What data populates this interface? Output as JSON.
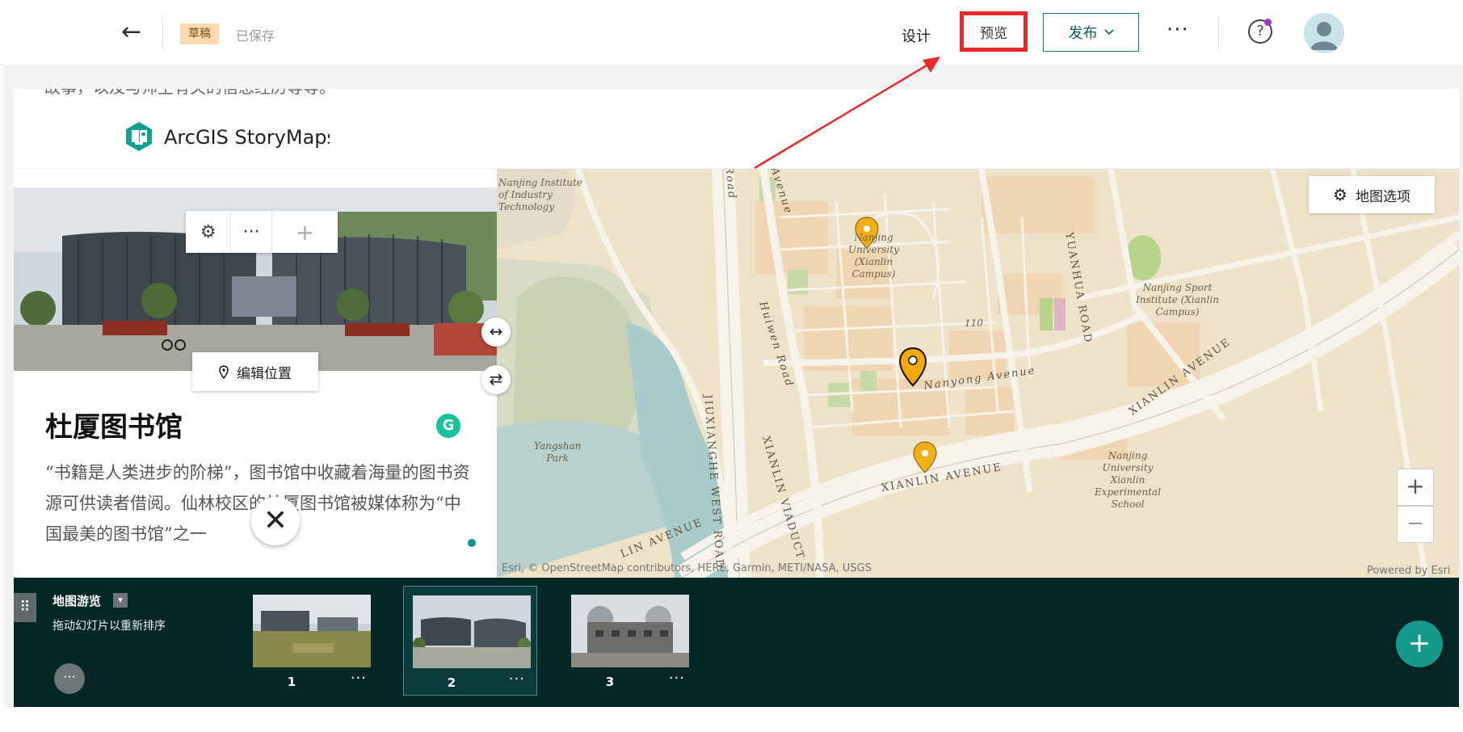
{
  "topbar": {
    "back_glyph": "←",
    "draft_badge": "草稿",
    "saved_status": "已保存",
    "design_label": "设计",
    "preview_label": "预览",
    "publish_label": "发布",
    "publish_chevron": "⌵",
    "more_glyph": "···",
    "help_glyph": "?",
    "highlight_color": "#ea2a2a"
  },
  "intro": {
    "text_fragment": "故事，以及与师生有关的信息经历等等。",
    "brand_name": "ArcGIS StoryMaps",
    "brand_color": "#13a18d"
  },
  "slide_panel": {
    "title": "杜厦图书馆",
    "body": "“书籍是人类进步的阶梯”，图书馆中收藏着海量的图书资源可供读者借阅。仙林校区的杜厦图书馆被媒体称为“中国最美的图书馆”之一",
    "edit_position_label": "编辑位置",
    "toolbar": {
      "settings_glyph": "⚙",
      "more_glyph": "···",
      "add_glyph": "+"
    },
    "close_glyph": "✕",
    "grammar_glyph": "G",
    "swap_glyphs": [
      "↔",
      "⇄"
    ]
  },
  "map": {
    "options_label": "地图选项",
    "zoom_in": "+",
    "zoom_out": "—",
    "attribution": "Esri, © OpenStreetMap contributors, HERE, Garmin, METI/NASA, USGS",
    "powered_by": "Powered by Esri",
    "pin_color": "#f2a900",
    "place_labels": {
      "nanjing_tech": [
        "Nanjing Institute",
        "of Industry",
        "Technology"
      ],
      "nju": [
        "Nanjing",
        "University",
        "(Xianlin",
        "Campus)"
      ],
      "sport": [
        "Nanjing Sport",
        "Institute (Xianlin",
        "Campus)"
      ],
      "yangshan": [
        "Yangshan",
        "Park"
      ],
      "school": [
        "Nanjing",
        "University",
        "Xianlin",
        "Experimental",
        "School"
      ],
      "marker_110": "110"
    },
    "road_labels": {
      "nanyong": "Nanyong Avenue",
      "xianlin_ave": "XIANLIN AVENUE",
      "xianlin_ave_ne": "XIANLIN AVENUE",
      "xianlin_ave_sw": "LIN AVENUE",
      "huiwen": "Huiwen Road",
      "yuanhua": "YUANHUA ROAD",
      "jiuxianghe": "JIUXIANGHE WEST ROAD",
      "viaduct": "XIANLIN VIADUCT",
      "avenue_top": "Avenue",
      "road_top": "Road"
    }
  },
  "map_tour": {
    "title": "地图游览",
    "hint": "拖动幻灯片以重新排序",
    "drag_glyph": "⠿",
    "dropdown_glyph": "▾",
    "more_glyph": "···",
    "add_glyph": "+",
    "slides": [
      {
        "number": "1",
        "more": "···"
      },
      {
        "number": "2",
        "more": "···"
      },
      {
        "number": "3",
        "more": "···"
      }
    ],
    "active_slide": 2
  }
}
